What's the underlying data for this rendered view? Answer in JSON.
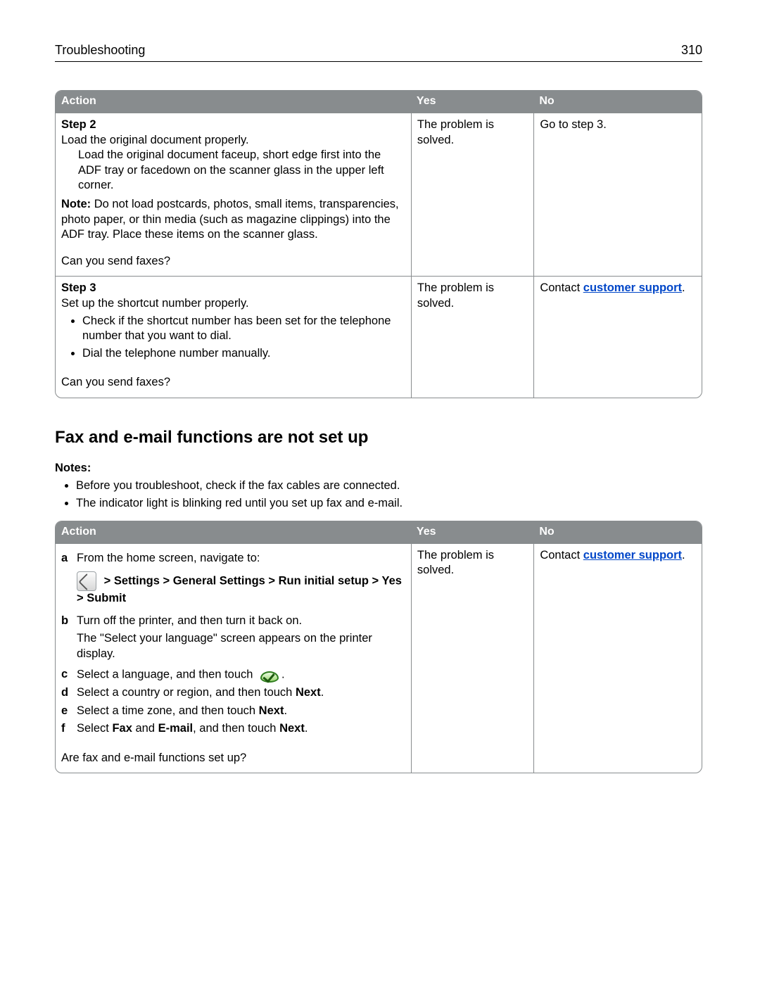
{
  "header": {
    "title": "Troubleshooting",
    "page": "310"
  },
  "table1": {
    "cols": [
      "Action",
      "Yes",
      "No"
    ],
    "step2": {
      "title": "Step 2",
      "line1": "Load the original document properly.",
      "detail": "Load the original document faceup, short edge first into the ADF tray or facedown on the scanner glass in the upper left corner.",
      "note_label": "Note:",
      "note": " Do not load postcards, photos, small items, transparencies, photo paper, or thin media (such as magazine clippings) into the ADF tray. Place these items on the scanner glass.",
      "question": "Can you send faxes?",
      "yes": "The problem is solved.",
      "no": "Go to step 3."
    },
    "step3": {
      "title": "Step 3",
      "line1": "Set up the shortcut number properly.",
      "b1": "Check if the shortcut number has been set for the telephone number that you want to dial.",
      "b2": "Dial the telephone number manually.",
      "question": "Can you send faxes?",
      "yes": "The problem is solved.",
      "no_prefix": "Contact ",
      "no_link": "customer support",
      "no_suffix": "."
    }
  },
  "section2": {
    "heading": "Fax and e-mail functions are not set up",
    "notes_label": "Notes:",
    "note1": "Before you troubleshoot, check if the fax cables are connected.",
    "note2": "The indicator light is blinking red until you set up fax and e‑mail."
  },
  "table2": {
    "cols": [
      "Action",
      "Yes",
      "No"
    ],
    "a_text": "From the home screen, navigate to:",
    "a_path_prefix": " > ",
    "a_path": "Settings > General Settings > Run initial setup > Yes > Submit",
    "b_text": "Turn off the printer, and then turn it back on.",
    "b_detail": "The \"Select your language\" screen appears on the printer display.",
    "c_text": "Select a language, and then touch ",
    "c_after": ".",
    "d_pre": "Select a country or region, and then touch ",
    "d_bold": "Next",
    "d_after": ".",
    "e_pre": "Select a time zone, and then touch ",
    "e_bold": "Next",
    "e_after": ".",
    "f_pre": "Select ",
    "f_b1": "Fax",
    "f_mid": " and ",
    "f_b2": "E‑mail",
    "f_mid2": ", and then touch ",
    "f_b3": "Next",
    "f_after": ".",
    "question": "Are fax and e‑mail functions set up?",
    "yes": "The problem is solved.",
    "no_prefix": "Contact ",
    "no_link": "customer support",
    "no_suffix": "."
  }
}
